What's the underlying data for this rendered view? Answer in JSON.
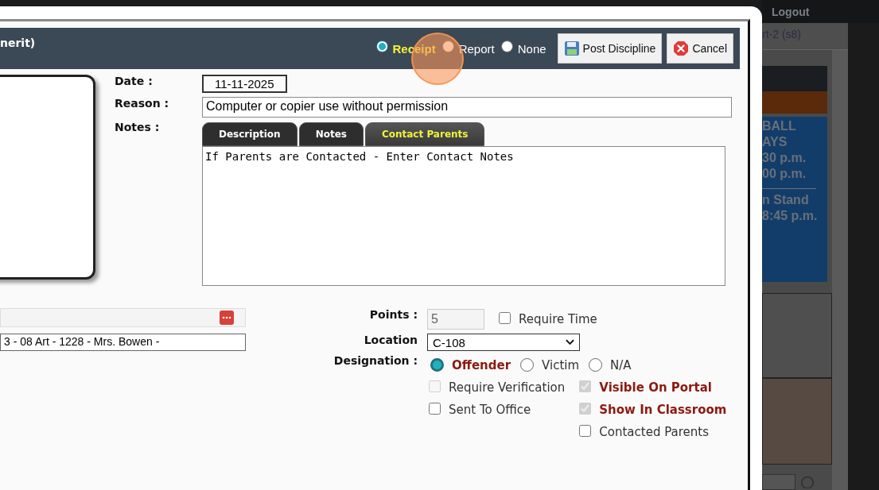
{
  "header": {
    "title": "nerit)",
    "print_options": [
      {
        "label": "Receipt",
        "selected": true
      },
      {
        "label": "Report",
        "selected": false
      },
      {
        "label": "None",
        "selected": false
      }
    ],
    "buttons": [
      {
        "label": "Post Discipline",
        "kind": "save"
      },
      {
        "label": "Cancel",
        "kind": "cancel"
      }
    ]
  },
  "form": {
    "date": {
      "label": "Date :",
      "value": "11-11-2025"
    },
    "reason": {
      "label": "Reason :",
      "value": "Computer or copier use without permission"
    },
    "notes": {
      "label": "Notes :",
      "tabs": [
        {
          "label": "Description",
          "selected": false
        },
        {
          "label": "Notes",
          "selected": false
        },
        {
          "label": "Contact Parents",
          "selected": true
        }
      ],
      "value": "If Parents are Contacted - Enter Contact Notes"
    }
  },
  "class_field": {
    "value": "3 - 08 Art - 1228 - Mrs. Bowen -"
  },
  "points": {
    "label": "Points :",
    "value": "5",
    "disabled": true
  },
  "require_time": {
    "label": "Require Time",
    "checked": false
  },
  "location": {
    "label": "Location",
    "value": "C-108"
  },
  "designation": {
    "label": "Designation :",
    "options": [
      {
        "label": "Offender",
        "selected": true
      },
      {
        "label": "Victim",
        "selected": false
      },
      {
        "label": "N/A",
        "selected": false
      }
    ]
  },
  "checkbox_columns": [
    [
      {
        "label": "Require Verification",
        "checked": false,
        "disabled": true
      },
      {
        "label": "Sent To Office",
        "checked": false,
        "disabled": false
      }
    ],
    [
      {
        "label": "Visible On Portal",
        "checked": true,
        "disabled": true
      },
      {
        "label": "Show In Classroom",
        "checked": true,
        "disabled": true
      },
      {
        "label": "Contacted Parents",
        "checked": false,
        "disabled": false
      }
    ]
  ],
  "background_page": {
    "logout": "Logout",
    "tab": "rt-2 (s8)",
    "notice_lines": [
      "BALL",
      "AYS",
      "30 p.m.",
      "00 p.m."
    ],
    "notice_lines_2": [
      "n Stand",
      "8:45 p.m."
    ]
  }
}
